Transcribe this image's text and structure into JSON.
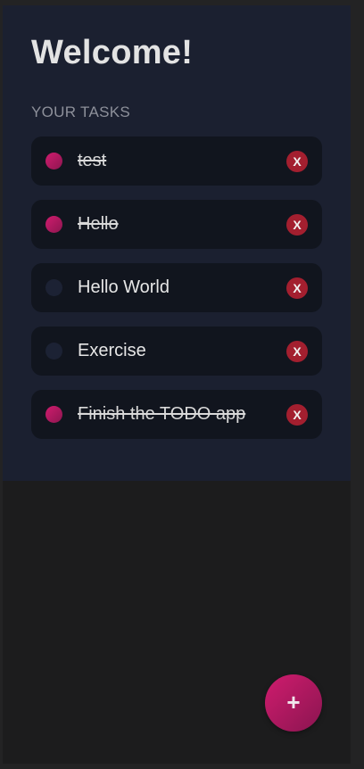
{
  "header": {
    "title": "Welcome!",
    "section_label": "YOUR TASKS"
  },
  "tasks": [
    {
      "text": "test",
      "done": true,
      "delete_label": "X"
    },
    {
      "text": "Hello",
      "done": true,
      "delete_label": "X"
    },
    {
      "text": "Hello World",
      "done": false,
      "delete_label": "X"
    },
    {
      "text": "Exercise",
      "done": false,
      "delete_label": "X"
    },
    {
      "text": "Finish the TODO app",
      "done": true,
      "delete_label": "X"
    }
  ],
  "fab": {
    "label": "+",
    "icon": "plus-icon"
  },
  "colors": {
    "accent": "#c71b68",
    "panel_bg": "#1b2030",
    "task_bg": "#11151e",
    "delete_bg": "#a31f2f"
  }
}
